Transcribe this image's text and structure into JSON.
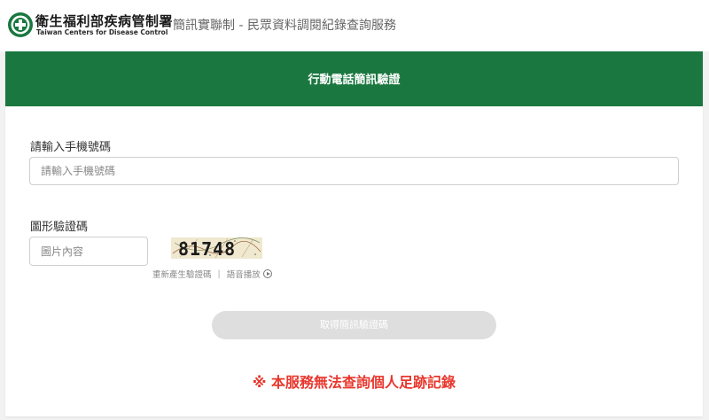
{
  "header": {
    "org_name": "衛生福利部疾病管制署",
    "org_name_en": "Taiwan Centers for Disease Control",
    "site_title": "簡訊實聯制 - 民眾資料調閱紀錄查詢服務",
    "brand_color": "#1a7740"
  },
  "card": {
    "title": "行動電話簡訊驗證",
    "phone": {
      "label": "請輸入手機號碼",
      "placeholder": "請輸入手機號碼",
      "value": ""
    },
    "captcha": {
      "label": "圖形驗證碼",
      "placeholder": "圖片內容",
      "value": "",
      "image_text": "81748",
      "refresh_label": "重新產生驗證碼",
      "separator": "|",
      "audio_label": "語音播放"
    },
    "submit_label": "取得簡訊驗證碼",
    "notice": "※ 本服務無法查詢個人足跡記錄",
    "notice_color": "#e8372d"
  }
}
